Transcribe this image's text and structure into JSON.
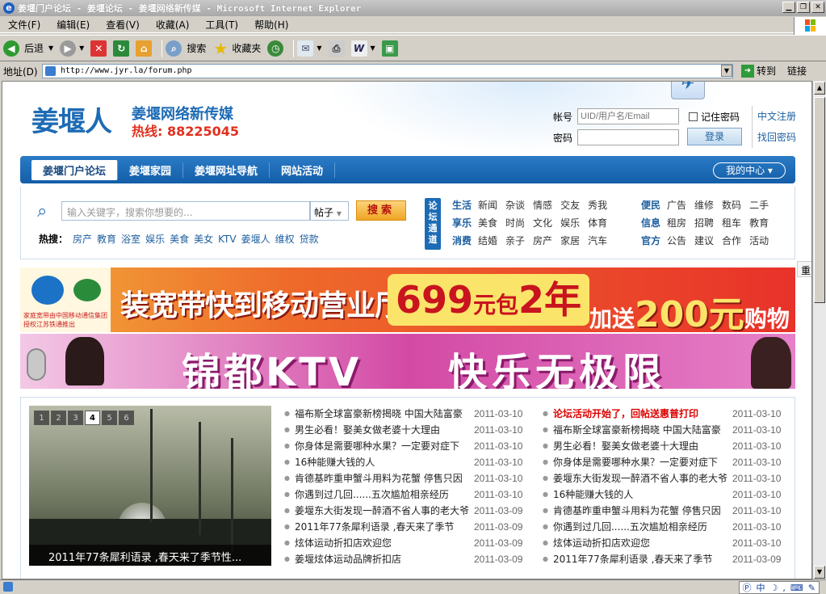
{
  "window": {
    "title": "姜堰门户论坛 - 姜堰论坛 - 姜堰网络新传媒 - Microsoft Internet Explorer"
  },
  "menu": [
    "文件(F)",
    "编辑(E)",
    "查看(V)",
    "收藏(A)",
    "工具(T)",
    "帮助(H)"
  ],
  "toolbar": {
    "back": "后退",
    "search": "搜索",
    "favorites": "收藏夹"
  },
  "address": {
    "label": "地址(D)",
    "url": "http://www.jyr.la/forum.php",
    "go": "转到",
    "links": "链接"
  },
  "site": {
    "logo": "姜堰人",
    "slogan": "姜堰网络新传媒",
    "hotline": "热线: 88225045",
    "login": {
      "account_label": "帐号",
      "account_placeholder": "UID/用户名/Email",
      "remember": "记住密码",
      "password_label": "密码",
      "button": "登录",
      "register": "中文注册",
      "recover": "找回密码"
    },
    "nav": [
      "姜堰门户论坛",
      "姜堰家园",
      "姜堰网址导航",
      "网站活动"
    ],
    "mycenter": "我的中心 ▾",
    "search": {
      "placeholder": "输入关键字，搜索你想要的...",
      "type": "帖子",
      "button": "搜索",
      "hot_label": "热搜：",
      "hot": [
        "房产",
        "教育",
        "浴室",
        "娱乐",
        "美食",
        "美女",
        "KTV",
        "姜堰人",
        "维权",
        "贷款"
      ]
    },
    "channel_label": "论坛通道",
    "channels": [
      {
        "head": "生活",
        "items": [
          "新闻",
          "杂谈",
          "情感",
          "交友",
          "秀我"
        ]
      },
      {
        "head": "享乐",
        "items": [
          "美食",
          "时尚",
          "文化",
          "娱乐",
          "体育"
        ]
      },
      {
        "head": "消费",
        "items": [
          "结婚",
          "亲子",
          "房产",
          "家居",
          "汽车"
        ]
      }
    ],
    "channels2": [
      {
        "head": "便民",
        "items": [
          "广告",
          "维修",
          "数码",
          "二手"
        ]
      },
      {
        "head": "信息",
        "items": [
          "租房",
          "招聘",
          "租车",
          "教育"
        ]
      },
      {
        "head": "官方",
        "items": [
          "公告",
          "建议",
          "合作",
          "活动"
        ]
      }
    ],
    "banner1": {
      "brand": "家庭宽带由中国移动通信集团授权江苏铁通推出",
      "main": "装宽带快到移动营业厅",
      "price": "699",
      "price_unit": "元包",
      "years": "2年",
      "gift": "加送",
      "gift_amount": "200元",
      "gift_item": "购物卡"
    },
    "banner2": {
      "title": "锦都KTV",
      "slogan": "快乐无极限"
    },
    "slideshow": {
      "tabs": [
        "1",
        "2",
        "3",
        "4",
        "5",
        "6"
      ],
      "active": 4,
      "caption": "2011年77条犀利语录 ,春天来了季节性..."
    },
    "list_left": [
      {
        "title": "福布斯全球富豪新榜揭晓 中国大陆富豪",
        "date": "2011-03-10"
      },
      {
        "title": "男生必看！娶美女做老婆十大理由",
        "date": "2011-03-10"
      },
      {
        "title": "你身体是需要哪种水果？一定要对症下",
        "date": "2011-03-10"
      },
      {
        "title": "16种能赚大钱的人",
        "date": "2011-03-10"
      },
      {
        "title": "肯德基昨重申蟹斗用料为花蟹 停售只因",
        "date": "2011-03-10"
      },
      {
        "title": "你遇到过几回......五次尴尬相亲经历",
        "date": "2011-03-10"
      },
      {
        "title": "姜堰东大街发现一醉酒不省人事的老大爷",
        "date": "2011-03-09"
      },
      {
        "title": "2011年77条犀利语录 ,春天来了季节",
        "date": "2011-03-09"
      },
      {
        "title": "炫体运动折扣店欢迎您",
        "date": "2011-03-09"
      },
      {
        "title": "姜堰炫体运动品牌折扣店",
        "date": "2011-03-09"
      }
    ],
    "list_right": [
      {
        "title": "论坛活动开始了，回帖送惠普打印",
        "date": "2011-03-10",
        "hot": true
      },
      {
        "title": "福布斯全球富豪新榜揭晓 中国大陆富豪",
        "date": "2011-03-10"
      },
      {
        "title": "男生必看！娶美女做老婆十大理由",
        "date": "2011-03-10"
      },
      {
        "title": "你身体是需要哪种水果？一定要对症下",
        "date": "2011-03-10"
      },
      {
        "title": "姜堰东大街发现一醉酒不省人事的老大爷",
        "date": "2011-03-10"
      },
      {
        "title": "16种能赚大钱的人",
        "date": "2011-03-10"
      },
      {
        "title": "肯德基昨重申蟹斗用料为花蟹 停售只因",
        "date": "2011-03-10"
      },
      {
        "title": "你遇到过几回......五次尴尬相亲经历",
        "date": "2011-03-10"
      },
      {
        "title": "炫体运动折扣店欢迎您",
        "date": "2011-03-10"
      },
      {
        "title": "2011年77条犀利语录 ,春天来了季节",
        "date": "2011-03-09"
      }
    ],
    "sidetab": "重"
  },
  "ime": {
    "mode": "中"
  }
}
